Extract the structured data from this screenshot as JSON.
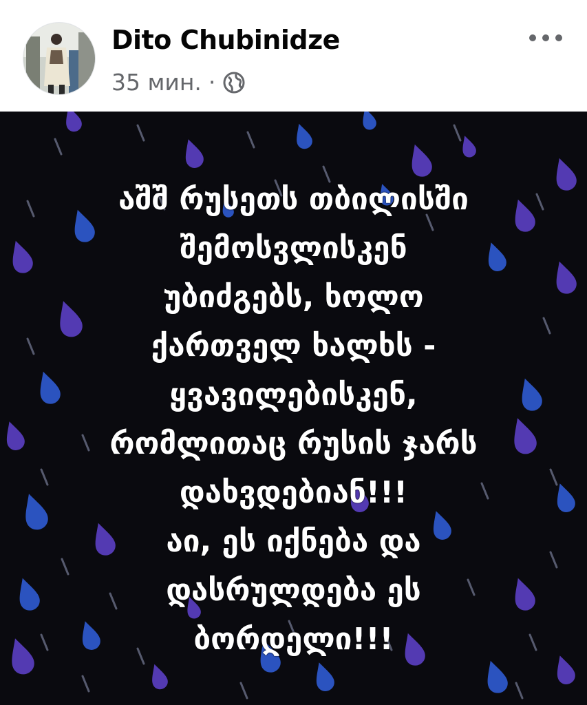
{
  "post": {
    "author_name": "Dito Chubinidze",
    "timestamp": "35 мин.",
    "separator": "·",
    "privacy_icon": "globe-icon",
    "menu_icon": "more-options-icon",
    "image_text": "აშშ  რუსეთს თბილისში\nშემოსვლისკენ\nუბიძგებს, ხოლო\nქართველ ხალხს -\nყვავილებისკენ,\nრომლითაც რუსის ჯარს\nდახვდებიან!!!\nაი, ეს იქნება და\nდასრულდება ეს\nბორდელი!!!"
  },
  "colors": {
    "name": "#050505",
    "meta": "#65676b",
    "image_background": "#0a0a0f",
    "drop_purple": "#5b3fc4",
    "drop_blue": "#2f5bd3",
    "text": "#ffffff"
  }
}
